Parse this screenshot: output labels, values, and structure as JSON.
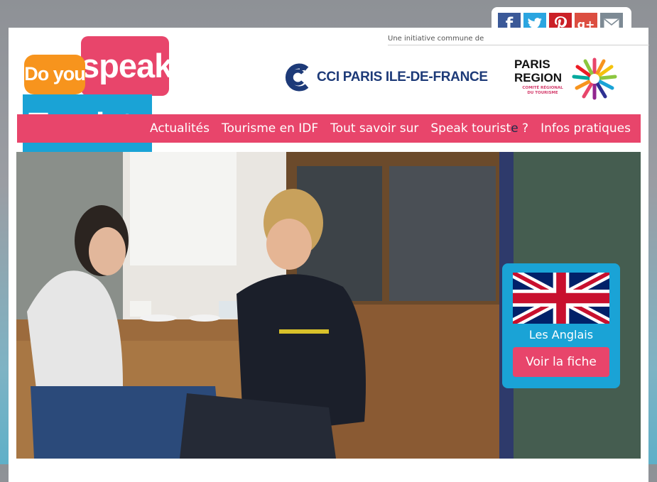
{
  "share": {
    "facebook_icon": "f",
    "google_plus_icon": "g+"
  },
  "header": {
    "initiative": "Une initiative commune de",
    "logo": {
      "line1": "Do you",
      "line2": "speak",
      "line3": "Touristq",
      "line3_dark": "e",
      "line3_end": " ?"
    },
    "partners": {
      "cci": "CCI PARIS ILE-DE-FRANCE",
      "paris_region_line1": "PARIS",
      "paris_region_line2": "REGION",
      "paris_region_sub": "COMITÉ RÉGIONAL DU TOURISME"
    }
  },
  "nav": {
    "items": [
      "Actualités",
      "Tourisme en IDF",
      "Tout savoir sur"
    ],
    "speak_prefix": "Speak tourist",
    "speak_dark": "e",
    "speak_suffix": " ?",
    "last": "Infos pratiques"
  },
  "feature": {
    "label": "Les Anglais",
    "button": "Voir la fiche"
  },
  "colors": {
    "pink": "#e8456b",
    "blue": "#1aa3d6",
    "orange": "#f7941d",
    "navy": "#1d3a78"
  }
}
